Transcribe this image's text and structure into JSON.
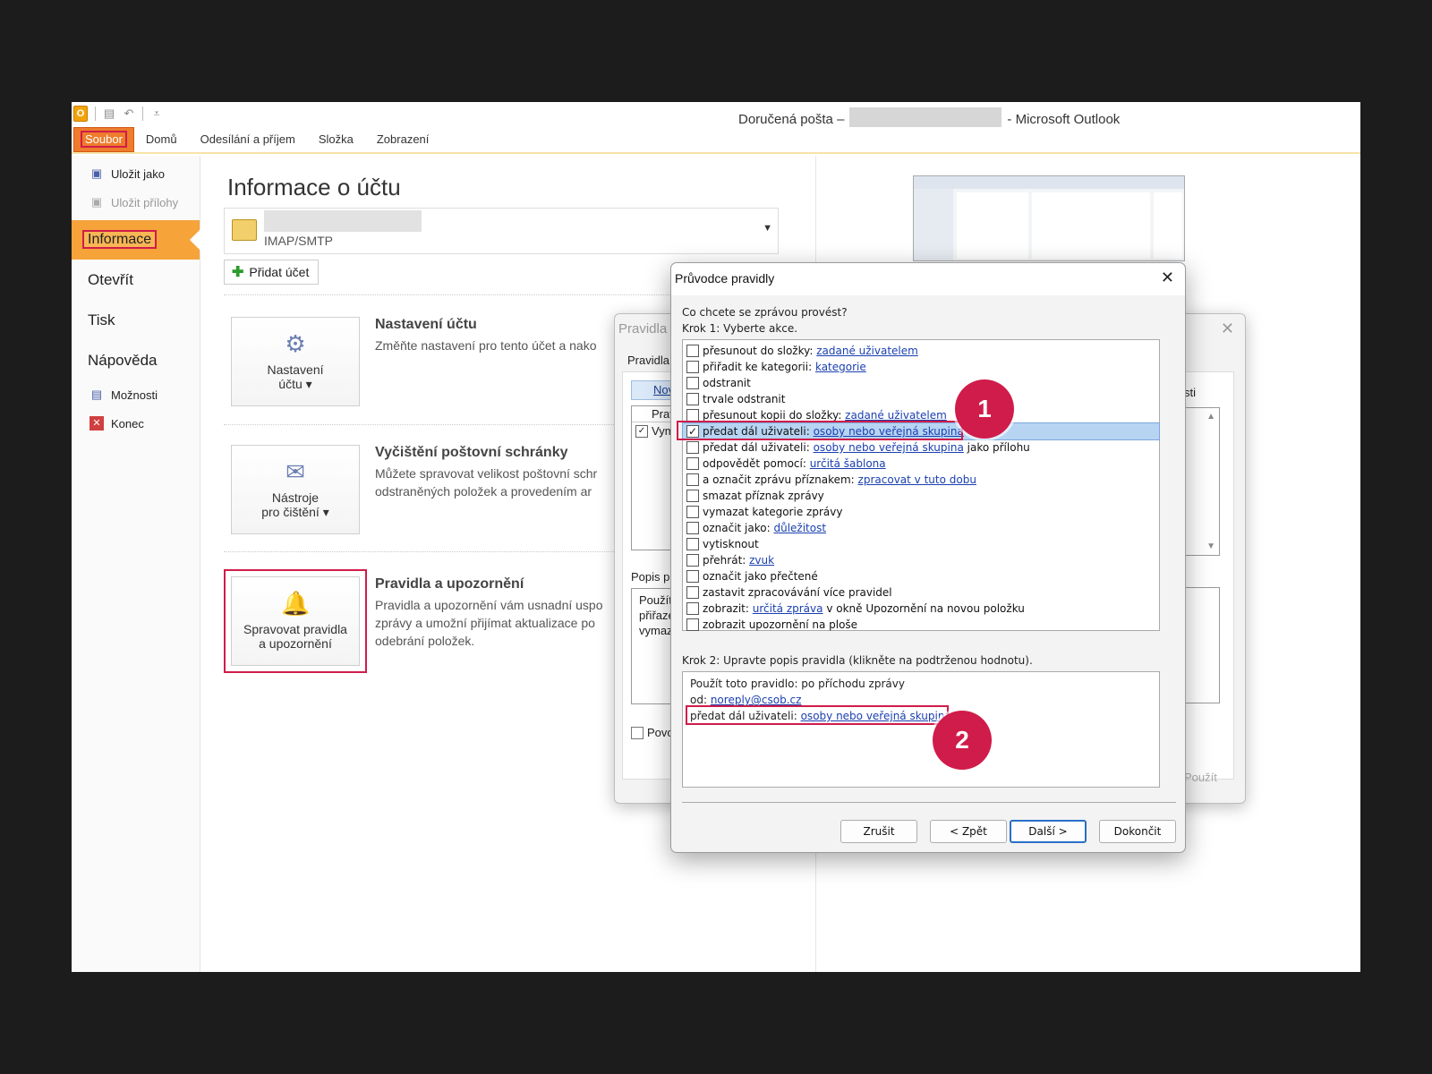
{
  "window": {
    "title_prefix": "Doručená pošta –",
    "title_suffix": "- Microsoft Outlook",
    "app_icon": "O"
  },
  "ribbon": {
    "tabs": [
      "Soubor",
      "Domů",
      "Odesílání a příjem",
      "Složka",
      "Zobrazení"
    ]
  },
  "backstage": {
    "save_as": "Uložit jako",
    "save_attachments": "Uložit přílohy",
    "info": "Informace",
    "open": "Otevřít",
    "print": "Tisk",
    "help": "Nápověda",
    "options": "Možnosti",
    "exit": "Konec"
  },
  "main": {
    "title": "Informace o účtu",
    "account_type": "IMAP/SMTP",
    "add_account": "Přidat účet",
    "sections": [
      {
        "button_line1": "Nastavení",
        "button_line2": "účtu ▾",
        "title": "Nastavení účtu",
        "text_lines": [
          "Změňte nastavení pro tento účet a nako"
        ]
      },
      {
        "button_line1": "Nástroje",
        "button_line2": "pro čištění ▾",
        "title": "Vyčištění poštovní schránky",
        "text_lines": [
          "Můžete spravovat velikost poštovní schr",
          "odstraněných položek a provedením ar"
        ]
      },
      {
        "button_line1": "Spravovat pravidla",
        "button_line2": "a upozornění",
        "title": "Pravidla a upozornění",
        "text_lines": [
          "Pravidla a upozornění vám usnadní uspo",
          "zprávy a umožní přijímat aktualizace po",
          "odebrání položek."
        ]
      }
    ]
  },
  "rules_dialog": {
    "title": "Pravidla a",
    "tab": "Pravidla",
    "new_button": "Nov",
    "list_header": "Prav",
    "list_row": "Vym",
    "desc_label": "Popis pr",
    "desc_lines": [
      "Použít",
      "přiřaze",
      "vymaz"
    ],
    "enable_checkbox": "Povo",
    "right_label": "sti",
    "apply": "Použít"
  },
  "wizard": {
    "title": "Průvodce pravidly",
    "question": "Co chcete se zprávou provést?",
    "step1": "Krok 1: Vyberte akce.",
    "actions": [
      {
        "text": "přesunout do složky: ",
        "link": "zadané uživatelem",
        "after": "",
        "checked": false
      },
      {
        "text": "přiřadit ke kategorii: ",
        "link": "kategorie",
        "after": "",
        "checked": false
      },
      {
        "text": "odstranit",
        "link": "",
        "after": "",
        "checked": false
      },
      {
        "text": "trvale odstranit",
        "link": "",
        "after": "",
        "checked": false
      },
      {
        "text": "přesunout kopii do složky: ",
        "link": "zadané uživatelem",
        "after": "",
        "checked": false
      },
      {
        "text": "předat dál uživateli: ",
        "link": "osoby nebo veřejná skupina",
        "after": "",
        "checked": true
      },
      {
        "text": "předat dál uživateli: ",
        "link": "osoby nebo veřejná skupina",
        "after": " jako přílohu",
        "checked": false
      },
      {
        "text": "odpovědět pomocí: ",
        "link": "určitá šablona",
        "after": "",
        "checked": false
      },
      {
        "text": "a označit zprávu příznakem: ",
        "link": "zpracovat v tuto dobu",
        "after": "",
        "checked": false
      },
      {
        "text": "smazat příznak zprávy",
        "link": "",
        "after": "",
        "checked": false
      },
      {
        "text": "vymazat kategorie zprávy",
        "link": "",
        "after": "",
        "checked": false
      },
      {
        "text": "označit jako: ",
        "link": "důležitost",
        "after": "",
        "checked": false
      },
      {
        "text": "vytisknout",
        "link": "",
        "after": "",
        "checked": false
      },
      {
        "text": "přehrát: ",
        "link": "zvuk",
        "after": "",
        "checked": false
      },
      {
        "text": "označit jako přečtené",
        "link": "",
        "after": "",
        "checked": false
      },
      {
        "text": "zastavit zpracovávání více pravidel",
        "link": "",
        "after": "",
        "checked": false
      },
      {
        "text": "zobrazit: ",
        "link": "určitá zpráva",
        "after": " v okně Upozornění na novou položku",
        "checked": false
      },
      {
        "text": "zobrazit upozornění na ploše",
        "link": "",
        "after": "",
        "checked": false
      }
    ],
    "step2": "Krok 2: Upravte popis pravidla (klikněte na podtrženou hodnotu).",
    "description": {
      "line1": "Použít toto pravidlo: po příchodu zprávy",
      "line2_prefix": "od: ",
      "line2_link": "noreply@csob.cz",
      "line3_prefix": "předat dál uživateli: ",
      "line3_link": "osoby nebo veřejná skupina"
    },
    "buttons": {
      "cancel": "Zrušit",
      "back": "< Zpět",
      "next": "Další >",
      "finish": "Dokončit"
    }
  },
  "annotations": {
    "badge1": "1",
    "badge2": "2"
  },
  "colors": {
    "file_tab": "#ee7c2c",
    "highlight": "#d01c4a",
    "selection": "#b7d4f3",
    "link": "#1a3fb0"
  }
}
